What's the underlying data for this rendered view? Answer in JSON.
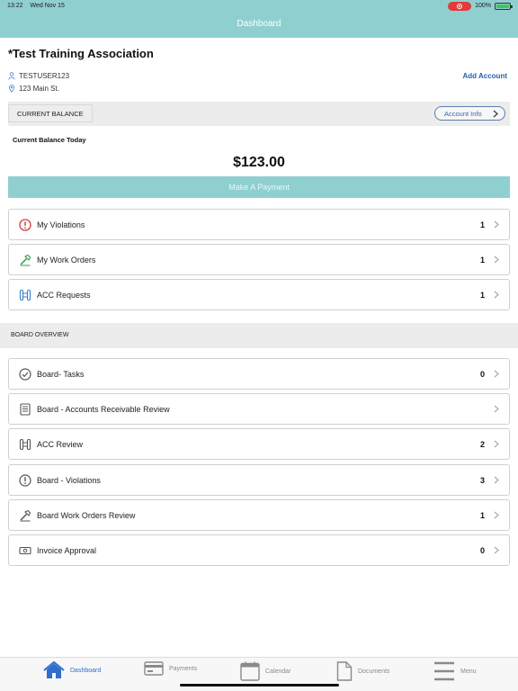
{
  "status_bar": {
    "time": "13:22",
    "date": "Wed Nov 15",
    "battery": "100%",
    "battery_level": 1.0
  },
  "nav": {
    "title": "Dashboard"
  },
  "colors": {
    "header": "#90cfcf",
    "accent_blue": "#2a5fa8",
    "violation_red": "#d93a3a",
    "work_order_green": "#2e9e4a",
    "acc_blue": "#3a7fd0"
  },
  "account": {
    "name": "*Test Training Association",
    "username": "TESTUSER123",
    "address": "123 Main St.",
    "add_account_label": "Add Account",
    "user_icon": "user-icon",
    "location_icon": "location-pin-icon"
  },
  "balance": {
    "tab_label": "CURRENT BALANCE",
    "account_info_label": "Account Info",
    "today_label": "Current Balance Today",
    "amount": "$123.00",
    "pay_button": "Make A Payment"
  },
  "my_items": [
    {
      "label": "My Violations",
      "count": "1",
      "icon": "alert-icon"
    },
    {
      "label": "My Work Orders",
      "count": "1",
      "icon": "hammer-icon"
    },
    {
      "label": "ACC Requests",
      "count": "1",
      "icon": "acc-icon"
    }
  ],
  "board_header": "BOARD OVERVIEW",
  "board_items": [
    {
      "label": "Board- Tasks",
      "count": "0",
      "icon": "check-circle-icon"
    },
    {
      "label": "Board - Accounts Receivable Review",
      "count": "",
      "icon": "ledger-icon"
    },
    {
      "label": "ACC Review",
      "count": "2",
      "icon": "acc-icon"
    },
    {
      "label": "Board - Violations",
      "count": "3",
      "icon": "alert-icon"
    },
    {
      "label": "Board Work Orders Review",
      "count": "1",
      "icon": "hammer-icon"
    },
    {
      "label": "Invoice Approval",
      "count": "0",
      "icon": "money-icon"
    }
  ],
  "tabs": [
    {
      "label": "Dashboard",
      "icon": "home-icon",
      "active": true
    },
    {
      "label": "Payments",
      "icon": "credit-card-icon",
      "active": false
    },
    {
      "label": "Calendar",
      "icon": "calendar-icon",
      "active": false
    },
    {
      "label": "Documents",
      "icon": "document-icon",
      "active": false
    },
    {
      "label": "Menu",
      "icon": "menu-icon",
      "active": false
    }
  ]
}
